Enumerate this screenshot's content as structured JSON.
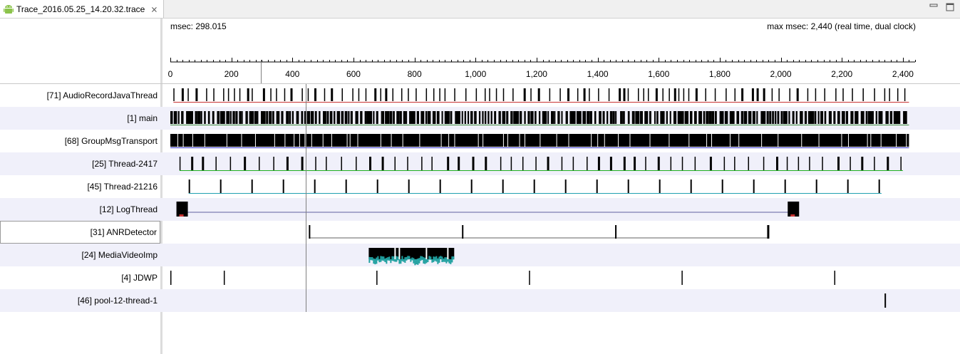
{
  "tab": {
    "title": "Trace_2016.05.25_14.20.32.trace",
    "close_glyph": "⨯",
    "icon": "android-icon"
  },
  "header": {
    "msec_label": "msec: 298.015",
    "max_msec_label": "max msec: 2,440 (real time, dual clock)"
  },
  "ruler": {
    "min": 0,
    "max": 2440,
    "tick_labels": [
      "0",
      "200",
      "400",
      "600",
      "800",
      "1,000",
      "1,200",
      "1,400",
      "1,600",
      "1,800",
      "2,000",
      "2,200",
      "2,400"
    ],
    "tick_values": [
      0,
      200,
      400,
      600,
      800,
      1000,
      1200,
      1400,
      1600,
      1800,
      2000,
      2200,
      2400
    ]
  },
  "cursor_msec": 445,
  "threads": [
    {
      "label": "[71] AudioRecordJavaThread",
      "color": "#c83232",
      "pattern": "dense-sparse",
      "start": 10,
      "end": 2420
    },
    {
      "label": "[1] main",
      "color": "#3c8c3c",
      "pattern": "dense",
      "start": 0,
      "end": 2420
    },
    {
      "label": "[68] GroupMsgTransport",
      "color": "#3232c8",
      "pattern": "solid",
      "start": 0,
      "end": 2420
    },
    {
      "label": "[25] Thread-2417",
      "color": "#20b020",
      "pattern": "periodic",
      "start": 30,
      "end": 2400
    },
    {
      "label": "[45] Thread-21216",
      "color": "#20a0b0",
      "pattern": "periodic-wide",
      "start": 60,
      "end": 2330
    },
    {
      "label": "[12] LogThread",
      "color": "#6060a0",
      "pattern": "log",
      "start": 20,
      "end": 2060
    },
    {
      "label": "[31] ANRDetector",
      "color": "#606060",
      "pattern": "anr",
      "start": 455,
      "end": 1960
    },
    {
      "label": "[24] MediaVideoImp",
      "color": "#20a0a0",
      "pattern": "media",
      "start": 650,
      "end": 930
    },
    {
      "label": "[4] JDWP",
      "color": "#404040",
      "pattern": "jdwp",
      "start": 0,
      "end": 2200
    },
    {
      "label": "[46] pool-12-thread-1",
      "color": "#404040",
      "pattern": "pool",
      "start": 2340,
      "end": 2345
    }
  ]
}
